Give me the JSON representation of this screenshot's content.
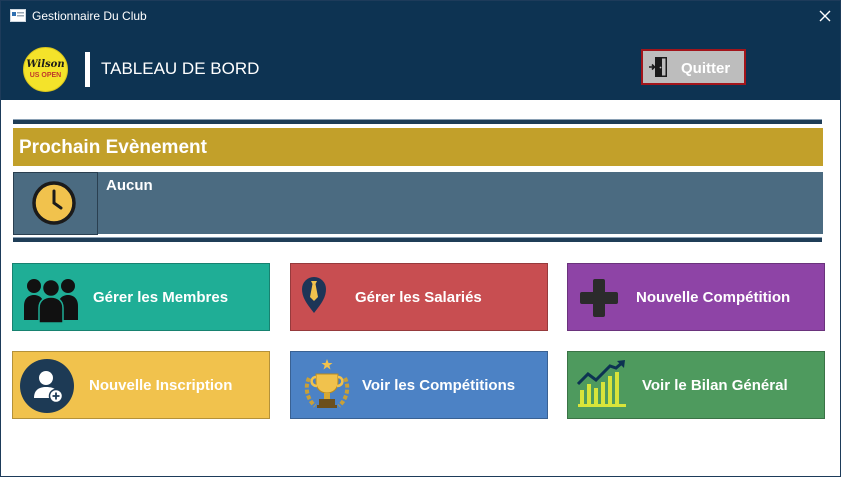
{
  "window": {
    "title": "Gestionnaire Du Club"
  },
  "header": {
    "logo_text_top": "Wilson",
    "logo_text_bottom": "US OPEN",
    "title": "TABLEAU DE BORD",
    "quit_label": "Quitter"
  },
  "event": {
    "heading": "Prochain Evènement",
    "value": "Aucun"
  },
  "tiles": [
    {
      "label": "Gérer les Membres",
      "color": "#1fae96",
      "icon": "group-icon"
    },
    {
      "label": "Gérer les Salariés",
      "color": "#c84e51",
      "icon": "employee-tie-icon"
    },
    {
      "label": "Nouvelle Compétition",
      "color": "#8e44a6",
      "icon": "plus-icon"
    },
    {
      "label": "Nouvelle Inscription",
      "color": "#f1c24d",
      "icon": "add-user-icon"
    },
    {
      "label": "Voir les Compétitions",
      "color": "#4c82c5",
      "icon": "trophy-icon"
    },
    {
      "label": "Voir le Bilan Général",
      "color": "#4e9a5e",
      "icon": "growth-chart-icon"
    }
  ],
  "colors": {
    "titlebar": "#0d3352",
    "event_heading_bg": "#c2a02a",
    "event_body_bg": "#4b6b81",
    "quit_border": "#a2151b"
  }
}
